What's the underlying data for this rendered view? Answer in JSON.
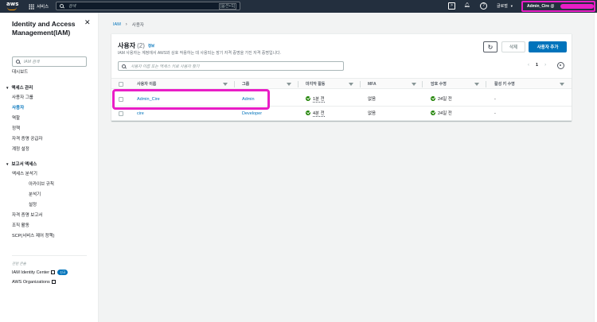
{
  "topnav": {
    "logo_text": "aws",
    "services_label": "서비스",
    "search_placeholder": "검색",
    "search_shortcut": "[옵션+S]",
    "region_label": "글로벌",
    "account_label": "Admin_Cire @"
  },
  "sidebar": {
    "title": "Identity and Access Management(IAM)",
    "search_placeholder": "IAM 검색",
    "dashboard": "대시보드",
    "access_mgmt": {
      "label": "액세스 관리",
      "items": [
        "사용자 그룹",
        "사용자",
        "역할",
        "정책",
        "자격 증명 공급자",
        "계정 설정"
      ]
    },
    "reports": {
      "label": "보고서 액세스",
      "analyzer": "액세스 분석기",
      "sub_items": [
        "아카이브 규칙",
        "분석기",
        "설정"
      ],
      "items": [
        "자격 증명 보고서",
        "조직 활동",
        "SCP(서비스 제어 정책)"
      ]
    },
    "related_label": "관련 콘솔",
    "related": [
      {
        "label": "IAM Identity Center",
        "badge": "신규"
      },
      {
        "label": "AWS Organizations"
      }
    ]
  },
  "breadcrumb": {
    "root": "IAM",
    "current": "사용자"
  },
  "panel": {
    "title": "사용자",
    "count": "(2)",
    "info": "정보",
    "description": "IAM 사용자는 계정에서 AWS와 상호 작용하는 데 사용되는 장기 자격 증명을 가진 자격 증명입니다.",
    "delete_label": "삭제",
    "add_label": "사용자 추가",
    "search_placeholder": "사용자 이름 또는 액세스 키로 사용자 찾기",
    "page": "1"
  },
  "table": {
    "columns": [
      "사용자 이름",
      "그룹",
      "마지막 활동",
      "MFA",
      "암호 수명",
      "활성 키 수명"
    ],
    "rows": [
      {
        "name": "Admin_Cire",
        "group": "Admin",
        "last_activity": "1분 전",
        "mfa": "없음",
        "password_age": "24일 전",
        "key_age": "-"
      },
      {
        "name": "cire",
        "group": "Developer",
        "last_activity": "4분 전",
        "mfa": "없음",
        "password_age": "24일 전",
        "key_age": "-"
      }
    ]
  },
  "colors": {
    "nav_bg": "#232f3e",
    "accent": "#0073bb",
    "highlight": "#e91ec6",
    "success": "#1d8102"
  }
}
